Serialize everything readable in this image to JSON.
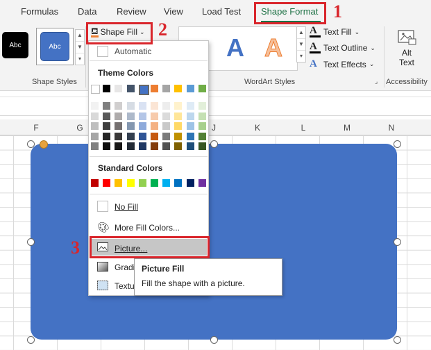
{
  "ribbon_tabs": [
    "Formulas",
    "Data",
    "Review",
    "View",
    "Load Test",
    "Shape Format"
  ],
  "active_tab": "Shape Format",
  "shape_styles": {
    "swatch_1_label": "Abc",
    "swatch_2_label": "Abc",
    "group_label": "Shape Styles"
  },
  "shape_fill_button": "Shape Fill",
  "wordart": {
    "letter": "A",
    "text_fill": "Text Fill",
    "text_outline": "Text Outline",
    "text_effects": "Text Effects",
    "group_label": "WordArt Styles"
  },
  "accessibility": {
    "alt_text_line1": "Alt",
    "alt_text_line2": "Text",
    "group_label": "Accessibility"
  },
  "columns": [
    "F",
    "G",
    "J",
    "K",
    "L",
    "M",
    "N"
  ],
  "menu": {
    "automatic": "Automatic",
    "theme_colors_heading": "Theme Colors",
    "theme_top_row": [
      "#ffffff",
      "#000000",
      "#e7e6e6",
      "#44546a",
      "#4472c4",
      "#ed7d31",
      "#a5a5a5",
      "#ffc000",
      "#5b9bd5",
      "#70ad47"
    ],
    "theme_shades": [
      [
        "#f2f2f2",
        "#d9d9d9",
        "#bfbfbf",
        "#a6a6a6",
        "#808080"
      ],
      [
        "#7f7f7f",
        "#595959",
        "#3f3f3f",
        "#262626",
        "#0d0d0d"
      ],
      [
        "#d0cece",
        "#aeabab",
        "#757070",
        "#3a3838",
        "#171616"
      ],
      [
        "#d6dce4",
        "#adb9ca",
        "#8497b0",
        "#333f4f",
        "#222a35"
      ],
      [
        "#d9e2f3",
        "#b4c6e7",
        "#8eaadb",
        "#2f5496",
        "#1f3864"
      ],
      [
        "#fbe5d5",
        "#f7cbac",
        "#f4b183",
        "#c55a11",
        "#833c0b"
      ],
      [
        "#ededed",
        "#dbdbdb",
        "#c9c9c9",
        "#7b7b7b",
        "#525252"
      ],
      [
        "#fff2cc",
        "#ffe699",
        "#ffd966",
        "#bf9000",
        "#7f6000"
      ],
      [
        "#deebf6",
        "#bdd7ee",
        "#9dc3e6",
        "#2e75b5",
        "#1e4e79"
      ],
      [
        "#e2efd9",
        "#c5e0b3",
        "#a8d08d",
        "#538135",
        "#375623"
      ]
    ],
    "standard_colors_heading": "Standard Colors",
    "standard_colors": [
      "#c00000",
      "#ff0000",
      "#ffc000",
      "#ffff00",
      "#92d050",
      "#00b050",
      "#00b0f0",
      "#0070c0",
      "#002060",
      "#7030a0"
    ],
    "no_fill": "No Fill",
    "more_fill_colors": "More Fill Colors...",
    "picture": "Picture...",
    "gradient": "Gradi",
    "texture": "Textu"
  },
  "tooltip": {
    "title": "Picture Fill",
    "description": "Fill the shape with a picture."
  },
  "annotations": [
    "1",
    "2",
    "3"
  ],
  "shape_color": "#4472c4",
  "annotation_color": "#d9262c"
}
